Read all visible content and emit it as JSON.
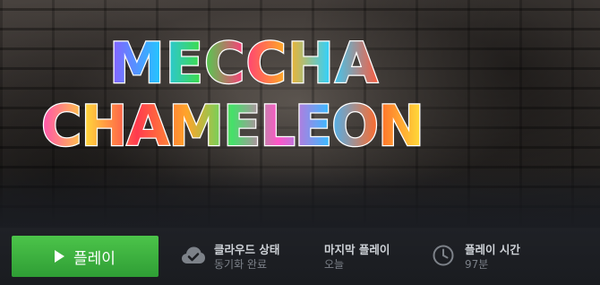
{
  "hero": {
    "logo_line1": "MECCHA",
    "logo_line2": "CHAMELEON"
  },
  "actions": {
    "play_label": "플레이",
    "play_color": "#3cb43e"
  },
  "stats": {
    "cloud_label": "클라우드 상태",
    "cloud_value": "동기화 완료",
    "last_played_label": "마지막 플레이",
    "last_played_value": "오늘",
    "playtime_label": "플레이 시간",
    "playtime_value": "97분"
  },
  "icons": {
    "play": "play-triangle-icon",
    "cloud": "cloud-check-icon",
    "clock": "clock-icon"
  }
}
